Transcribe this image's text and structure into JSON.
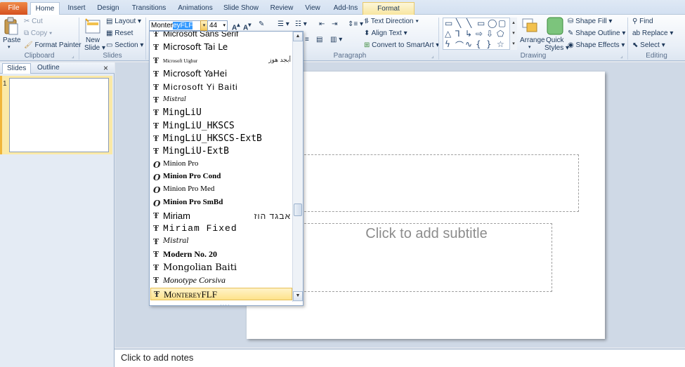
{
  "tabs": {
    "file": "File",
    "home": "Home",
    "insert": "Insert",
    "design": "Design",
    "transitions": "Transitions",
    "animations": "Animations",
    "slideshow": "Slide Show",
    "review": "Review",
    "view": "View",
    "addins": "Add-Ins",
    "format": "Format"
  },
  "clipboard": {
    "paste": "Paste",
    "cut": "Cut",
    "copy": "Copy",
    "format_painter": "Format Painter",
    "label": "Clipboard"
  },
  "slides_group": {
    "new_slide_1": "New",
    "new_slide_2": "Slide",
    "layout": "Layout",
    "reset": "Reset",
    "section": "Section",
    "label": "Slides"
  },
  "font": {
    "name_prefix": "Monter",
    "name_selected": "eyFLF",
    "size": "44"
  },
  "paragraph": {
    "text_direction": "Text Direction",
    "align_text": "Align Text",
    "convert_smartart": "Convert to SmartArt",
    "label": "Paragraph"
  },
  "drawing": {
    "arrange": "Arrange",
    "quick_styles_1": "Quick",
    "quick_styles_2": "Styles",
    "shape_fill": "Shape Fill",
    "shape_outline": "Shape Outline",
    "shape_effects": "Shape Effects",
    "label": "Drawing"
  },
  "editing": {
    "find": "Find",
    "replace": "Replace",
    "select": "Select",
    "label": "Editing"
  },
  "font_list": [
    {
      "name": "Microsoft Sans Serif",
      "icon": "truetype-icon",
      "sample": ""
    },
    {
      "name": "Microsoft Tai Le",
      "icon": "truetype-icon",
      "sample": ""
    },
    {
      "name": "Microsoft Uighur",
      "icon": "truetype-icon",
      "sample": "أبجد هوز"
    },
    {
      "name": "Microsoft YaHei",
      "icon": "truetype-icon",
      "sample": ""
    },
    {
      "name": "Microsoft Yi Baiti",
      "icon": "truetype-icon",
      "sample": ""
    },
    {
      "name": "Mistral",
      "icon": "truetype-icon",
      "sample": ""
    },
    {
      "name": "MingLiU",
      "icon": "truetype-icon",
      "sample": ""
    },
    {
      "name": "MingLiU_HKSCS",
      "icon": "truetype-icon",
      "sample": ""
    },
    {
      "name": "MingLiU_HKSCS-ExtB",
      "icon": "truetype-icon",
      "sample": ""
    },
    {
      "name": "MingLiU-ExtB",
      "icon": "truetype-icon",
      "sample": ""
    },
    {
      "name": "Minion Pro",
      "icon": "opentype-icon",
      "sample": ""
    },
    {
      "name": "Minion Pro Cond",
      "icon": "opentype-icon",
      "sample": ""
    },
    {
      "name": "Minion Pro Med",
      "icon": "opentype-icon",
      "sample": ""
    },
    {
      "name": "Minion Pro SmBd",
      "icon": "opentype-icon",
      "sample": ""
    },
    {
      "name": "Miriam",
      "icon": "truetype-icon",
      "sample": "אבגד הוז"
    },
    {
      "name": "Miriam Fixed",
      "icon": "truetype-icon",
      "sample": ""
    },
    {
      "name": "Mistral",
      "icon": "truetype-icon",
      "sample": ""
    },
    {
      "name": "Modern No. 20",
      "icon": "truetype-icon",
      "sample": ""
    },
    {
      "name": "Mongolian Baiti",
      "icon": "truetype-icon",
      "sample": ""
    },
    {
      "name": "Monotype Corsiva",
      "icon": "truetype-icon",
      "sample": ""
    },
    {
      "name": "MontereyFLF",
      "icon": "truetype-icon",
      "sample": ""
    }
  ],
  "left_pane": {
    "tab_slides": "Slides",
    "tab_outline": "Outline",
    "close": "×",
    "slide_number": "1"
  },
  "slide": {
    "subtitle_placeholder": "Click to add subtitle"
  },
  "notes": {
    "placeholder": "Click to add notes"
  },
  "colors": {
    "file_tab": "#d5501f",
    "highlight": "#fde28a",
    "accent": "#1e395b"
  }
}
